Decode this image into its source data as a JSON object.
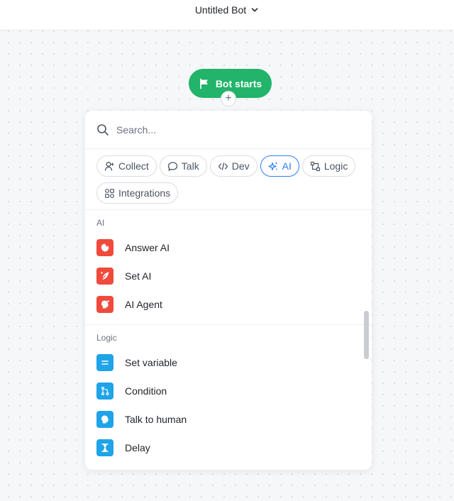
{
  "header": {
    "title": "Untitled Bot"
  },
  "canvas": {
    "start_node_label": "Bot starts",
    "add_handle": "+"
  },
  "panel": {
    "search": {
      "placeholder": "Search...",
      "value": ""
    },
    "categories": [
      {
        "label": "Collect",
        "icon": "user-icon"
      },
      {
        "label": "Talk",
        "icon": "chat-bubble-icon"
      },
      {
        "label": "Dev",
        "icon": "code-icon"
      },
      {
        "label": "AI",
        "icon": "sparkles-icon",
        "active": true
      },
      {
        "label": "Logic",
        "icon": "flow-icon"
      },
      {
        "label": "Integrations",
        "icon": "apps-icon"
      }
    ],
    "sections": [
      {
        "title": "AI",
        "items": [
          {
            "label": "Answer AI",
            "icon": "brain-icon",
            "color": "#ef4a3c"
          },
          {
            "label": "Set AI",
            "icon": "feather-icon",
            "color": "#ef4a3c"
          },
          {
            "label": "AI Agent",
            "icon": "agent-head-icon",
            "color": "#ef4a3c"
          }
        ]
      },
      {
        "title": "Logic",
        "items": [
          {
            "label": "Set variable",
            "icon": "equals-icon",
            "color": "#1ea4e9"
          },
          {
            "label": "Condition",
            "icon": "branch-icon",
            "color": "#1ea4e9"
          },
          {
            "label": "Talk to human",
            "icon": "human-head-icon",
            "color": "#1ea4e9"
          },
          {
            "label": "Delay",
            "icon": "hourglass-icon",
            "color": "#1ea4e9"
          }
        ]
      }
    ]
  },
  "colors": {
    "accent": "#2f7cf6",
    "start_green": "#22b46a",
    "ai_red": "#ef4a3c",
    "logic_blue": "#1ea4e9"
  }
}
